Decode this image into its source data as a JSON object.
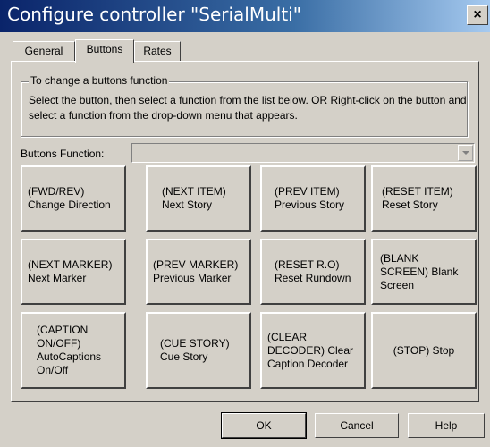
{
  "window": {
    "title": "Configure controller \"SerialMulti\"",
    "close_glyph": "×"
  },
  "tabs": [
    {
      "label": "General",
      "active": false
    },
    {
      "label": "Buttons",
      "active": true
    },
    {
      "label": "Rates",
      "active": false
    }
  ],
  "group": {
    "legend": "To change a buttons function",
    "text": "Select the button, then select a function from the list below. OR Right-click on the button and select a function from the drop-down menu that appears."
  },
  "buttons_function": {
    "label": "Buttons Function:",
    "value": ""
  },
  "controller_buttons": [
    "(FWD/REV) Change Direction",
    "(NEXT ITEM) Next Story",
    "(PREV ITEM) Previous Story",
    "(RESET ITEM) Reset Story",
    "(NEXT MARKER) Next Marker",
    "(PREV MARKER) Previous Marker",
    "(RESET R.O) Reset Rundown",
    "(BLANK SCREEN) Blank Screen",
    "(CAPTION ON/OFF) AutoCaptions On/Off",
    "(CUE STORY) Cue Story",
    "(CLEAR DECODER) Clear Caption Decoder",
    "(STOP) Stop"
  ],
  "dialog_buttons": {
    "ok": "OK",
    "cancel": "Cancel",
    "help": "Help"
  },
  "colors": {
    "title_gradient_start": "#0a246a",
    "title_gradient_end": "#a6caf0",
    "face": "#d4d0c8"
  }
}
